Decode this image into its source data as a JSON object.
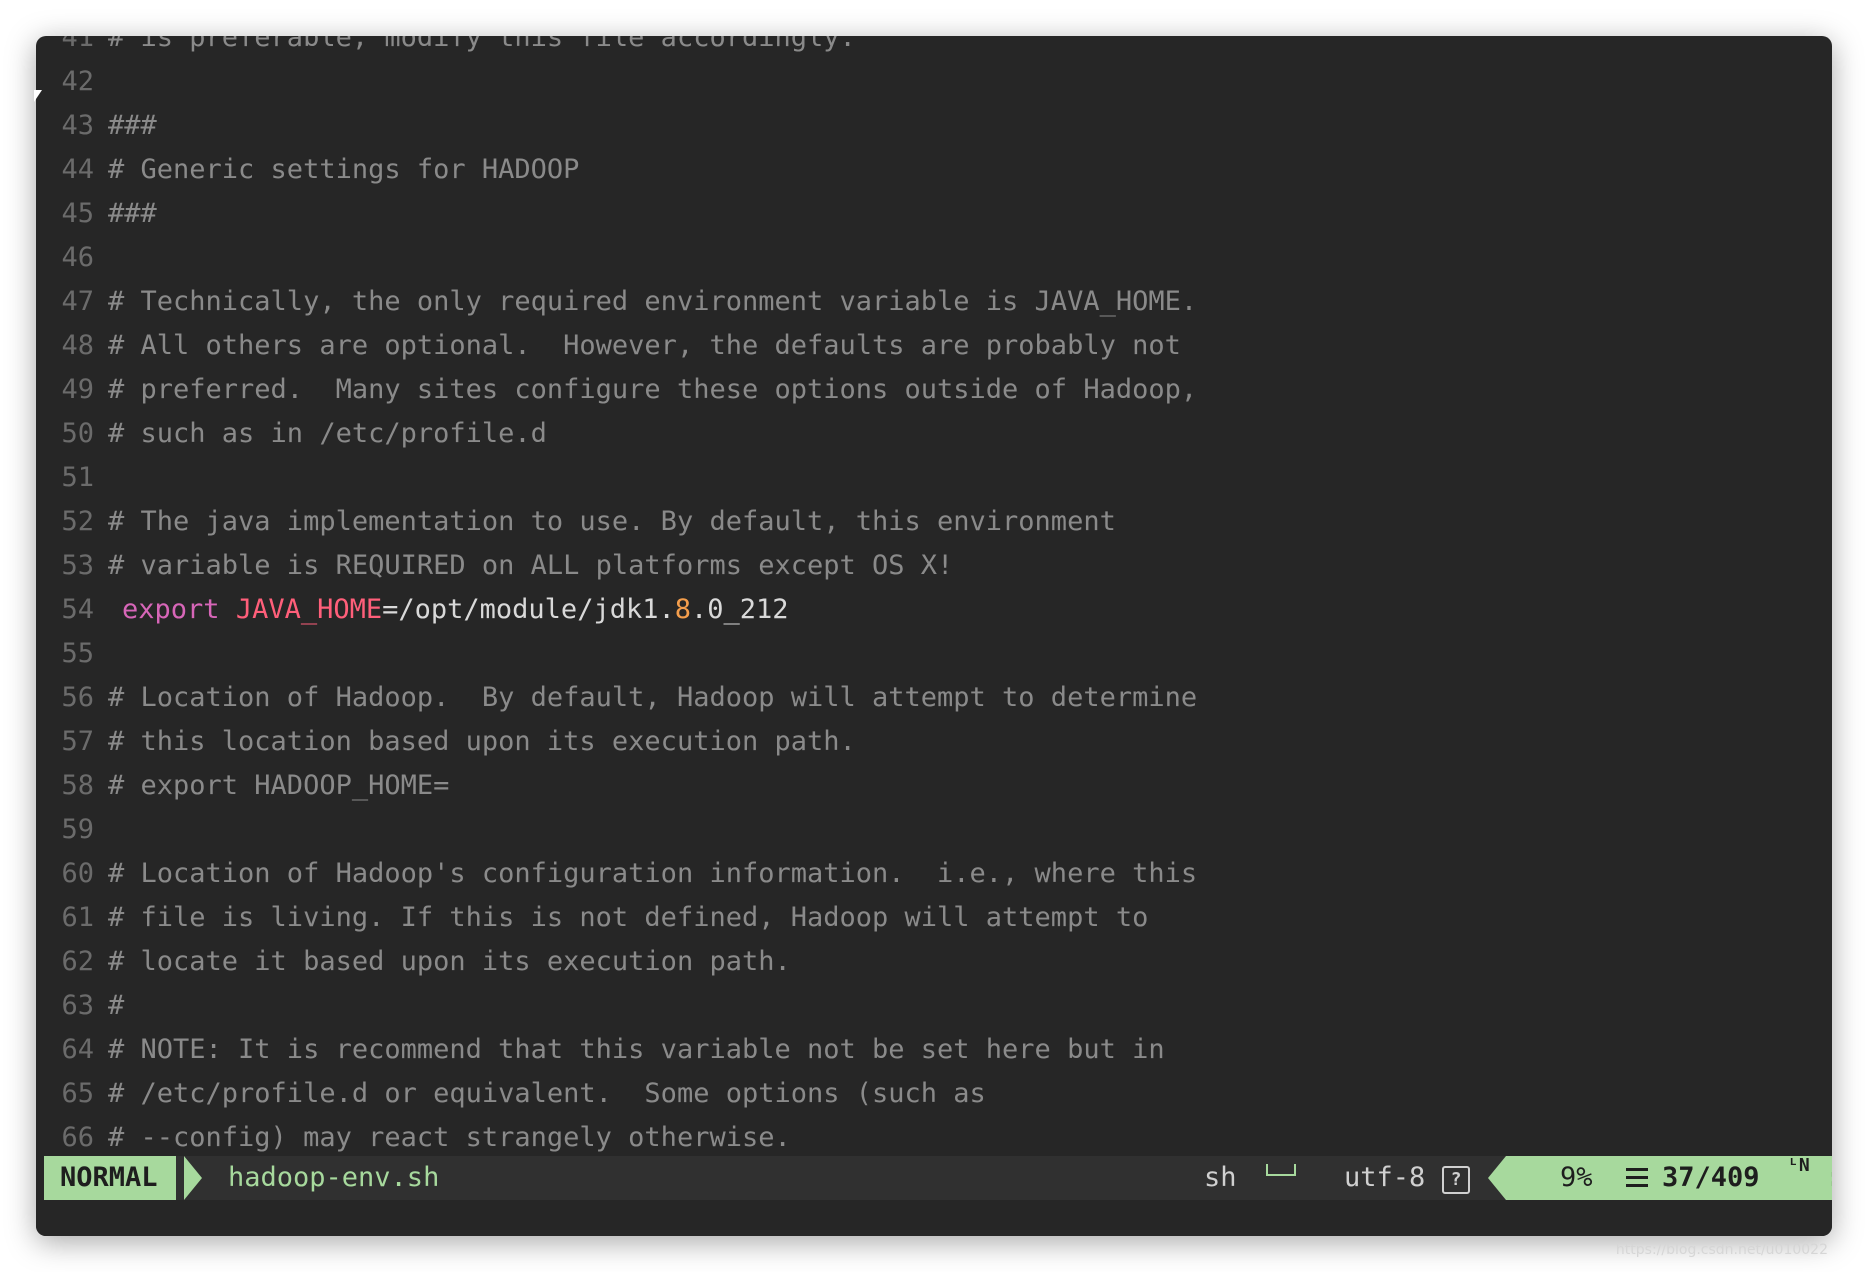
{
  "editor": {
    "lines": [
      {
        "n": "41",
        "text": "# is preferable, modify this file accordingly."
      },
      {
        "n": "42",
        "text": ""
      },
      {
        "n": "43",
        "text": "###"
      },
      {
        "n": "44",
        "text": "# Generic settings for HADOOP"
      },
      {
        "n": "45",
        "text": "###"
      },
      {
        "n": "46",
        "text": ""
      },
      {
        "n": "47",
        "text": "# Technically, the only required environment variable is JAVA_HOME."
      },
      {
        "n": "48",
        "text": "# All others are optional.  However, the defaults are probably not"
      },
      {
        "n": "49",
        "text": "# preferred.  Many sites configure these options outside of Hadoop,"
      },
      {
        "n": "50",
        "text": "# such as in /etc/profile.d"
      },
      {
        "n": "51",
        "text": ""
      },
      {
        "n": "52",
        "text": "# The java implementation to use. By default, this environment"
      },
      {
        "n": "53",
        "text": "# variable is REQUIRED on ALL platforms except OS X!"
      },
      {
        "n": "54",
        "code": true,
        "kw": "export",
        "var": "JAVA_HOME",
        "eq": "=/opt/module/jdk1.",
        "num": "8",
        "rest": ".0_212"
      },
      {
        "n": "55",
        "text": ""
      },
      {
        "n": "56",
        "text": "# Location of Hadoop.  By default, Hadoop will attempt to determine"
      },
      {
        "n": "57",
        "text": "# this location based upon its execution path."
      },
      {
        "n": "58",
        "text": "# export HADOOP_HOME="
      },
      {
        "n": "59",
        "text": ""
      },
      {
        "n": "60",
        "text": "# Location of Hadoop's configuration information.  i.e., where this"
      },
      {
        "n": "61",
        "text": "# file is living. If this is not defined, Hadoop will attempt to"
      },
      {
        "n": "62",
        "text": "# locate it based upon its execution path."
      },
      {
        "n": "63",
        "text": "#"
      },
      {
        "n": "64",
        "text": "# NOTE: It is recommend that this variable not be set here but in"
      },
      {
        "n": "65",
        "text": "# /etc/profile.d or equivalent.  Some options (such as"
      },
      {
        "n": "66",
        "text": "# --config) may react strangely otherwise."
      }
    ]
  },
  "statusbar": {
    "mode": "NORMAL",
    "filename": "hadoop-env.sh",
    "filetype": "sh",
    "encoding": "utf-8",
    "help_glyph": "?",
    "percent": "9%",
    "position": "37/409",
    "ln_glyph": "ᴸN",
    "colon": ":"
  },
  "watermark": "https://blog.csdn.net/u010022"
}
